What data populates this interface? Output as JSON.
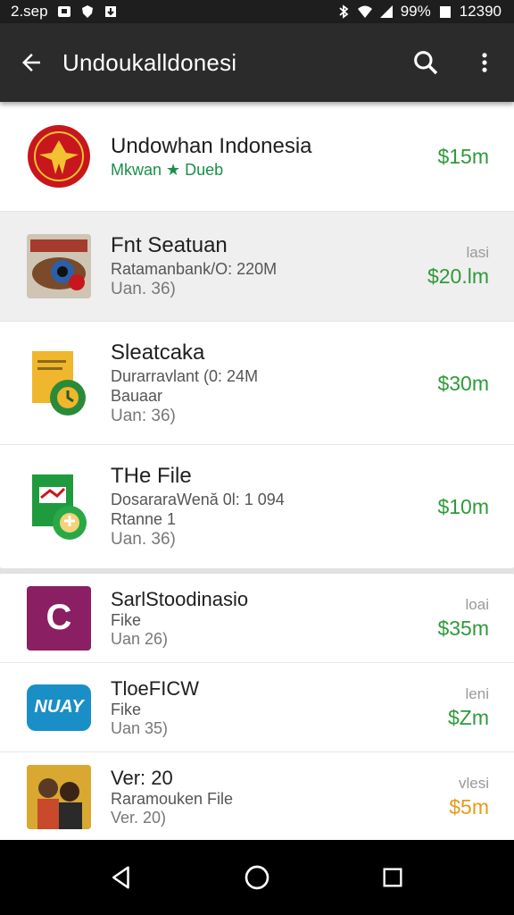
{
  "status_bar": {
    "time_left": "2.sep",
    "battery": "99%",
    "clock": "12390"
  },
  "app_bar": {
    "title": "Undoukalldonesi",
    "icons": [
      "back-arrow-icon",
      "search-icon",
      "more-vert-icon"
    ]
  },
  "items": [
    {
      "name": "Undowhan Indonesia",
      "sub": "Mkwan ★ Dueb",
      "version": "",
      "tag": "",
      "price": "$15m"
    },
    {
      "name": "Fnt Seatuan",
      "sub": "Ratamanbank/O: 220M",
      "version": "Uan. 36)",
      "tag": "lasi",
      "price": "$20.lm"
    },
    {
      "name": "Sleatcaka",
      "sub": "Durarravlant (0: 24M",
      "sub2": "Bauaar",
      "version": "Uan: 36)",
      "tag": "",
      "price": "$30m"
    },
    {
      "name": "THe File",
      "sub": "DosararaWenă 0l: 1 094",
      "sub2": "Rtanne 1",
      "version": "Uan. 36)",
      "tag": "",
      "price": "$10m"
    },
    {
      "name": "SarlStoodinasio",
      "sub": "Fike",
      "version": "Uan 26)",
      "tag": "loai",
      "price": "$35m"
    },
    {
      "name": "TloeFICW",
      "sub": "Fike",
      "version": "Uan 35)",
      "tag": "leni",
      "price": "$Zm"
    },
    {
      "name": "Ver: 20",
      "sub": "Raramouken File",
      "version": "Ver. 20)",
      "tag": "vlesi",
      "price": "$5m"
    }
  ],
  "icon_texts": {
    "app5": "C",
    "app6": "NUAY"
  },
  "colors": {
    "price_green": "#2e9a3b",
    "price_orange": "#e69a18",
    "appbar": "#2b2b2b",
    "subtitle_green": "#1a8f4a"
  },
  "nav": [
    "back-triangle-icon",
    "home-circle-icon",
    "recents-square-icon"
  ]
}
